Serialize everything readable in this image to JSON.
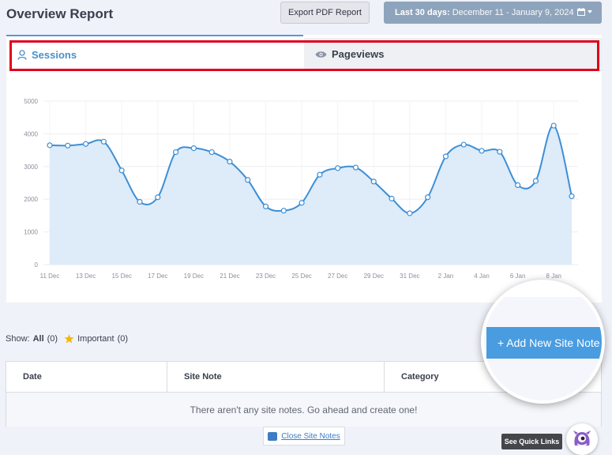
{
  "header": {
    "title": "Overview Report",
    "export_label": "Export PDF Report",
    "date_range_prefix": "Last 30 days:",
    "date_range_value": "December 11 - January 9, 2024"
  },
  "tabs": [
    {
      "label": "Sessions",
      "icon": "user-icon",
      "active": true
    },
    {
      "label": "Pageviews",
      "icon": "eye-icon",
      "active": false
    }
  ],
  "chart_data": {
    "type": "area",
    "series": [
      {
        "x": [
          "11 Dec",
          "12 Dec",
          "13 Dec",
          "14 Dec",
          "15 Dec",
          "16 Dec",
          "17 Dec",
          "18 Dec",
          "19 Dec",
          "20 Dec",
          "21 Dec",
          "22 Dec",
          "23 Dec",
          "24 Dec",
          "25 Dec",
          "26 Dec",
          "27 Dec",
          "28 Dec",
          "29 Dec",
          "30 Dec",
          "31 Dec",
          "1 Jan",
          "2 Jan",
          "3 Jan",
          "4 Jan",
          "5 Jan",
          "6 Jan",
          "7 Jan",
          "8 Jan",
          "9 Jan"
        ],
        "values": [
          3650,
          3640,
          3690,
          3760,
          2880,
          1920,
          2060,
          3440,
          3560,
          3440,
          3150,
          2590,
          1780,
          1650,
          1890,
          2750,
          2950,
          2970,
          2540,
          2020,
          1570,
          2060,
          3310,
          3670,
          3480,
          3450,
          2430,
          2560,
          4250,
          2090
        ]
      }
    ],
    "xticks": [
      "11 Dec",
      "13 Dec",
      "15 Dec",
      "17 Dec",
      "19 Dec",
      "21 Dec",
      "23 Dec",
      "25 Dec",
      "27 Dec",
      "29 Dec",
      "31 Dec",
      "2 Jan",
      "4 Jan",
      "6 Jan",
      "8 Jan"
    ],
    "yticks": [
      "0",
      "1000",
      "2000",
      "3000",
      "4000",
      "5000"
    ],
    "ylim": [
      0,
      5000
    ],
    "grid": true,
    "line_color": "#3d8fd6",
    "fill_color": "#deebf8"
  },
  "notes": {
    "show_label": "Show:",
    "all_label": "All",
    "all_count": "(0)",
    "important_label": "Important",
    "important_count": "(0)",
    "add_label": "+ Add New Site Note",
    "columns": [
      "Date",
      "Site Note",
      "Category"
    ],
    "empty_text": "There aren't any site notes. Go ahead and create one!",
    "close_label": "Close Site Notes"
  },
  "quick_links_label": "See Quick Links"
}
